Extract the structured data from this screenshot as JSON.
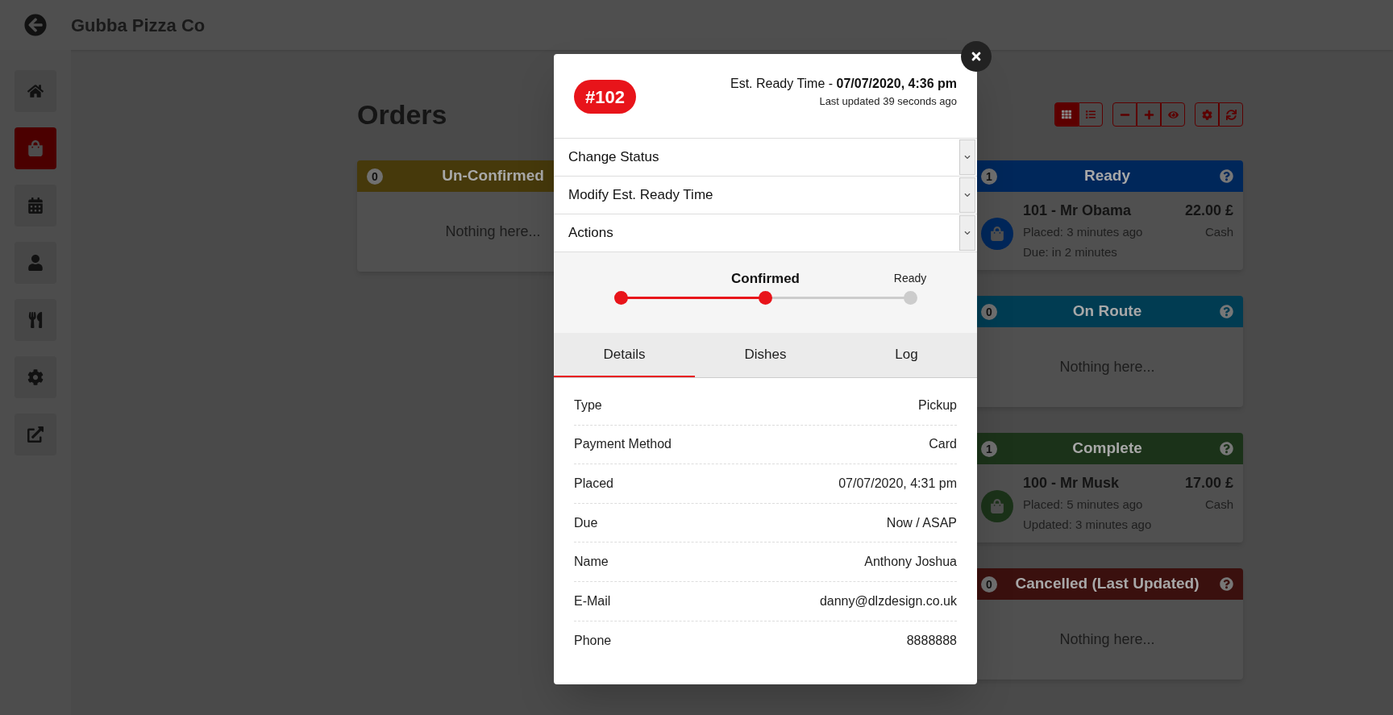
{
  "header": {
    "title": "Gubba Pizza Co"
  },
  "sidebar": {
    "items": [
      {
        "selected": false
      },
      {
        "selected": true
      },
      {
        "selected": false
      },
      {
        "selected": false
      },
      {
        "selected": false
      },
      {
        "selected": false
      },
      {
        "selected": false
      }
    ]
  },
  "page": {
    "title": "Orders"
  },
  "toolbar": {
    "view_toggle": [
      {
        "selected": true
      },
      {
        "selected": false
      }
    ]
  },
  "columns": [
    [
      {
        "title": "Un-Confirmed",
        "count": "0",
        "color": "#46390b",
        "empty_text": "Nothing here..."
      }
    ],
    [],
    [
      {
        "title": "Ready",
        "count": "1",
        "color": "#00275a",
        "orders": [
          {
            "title": "101 - Mr Obama",
            "lines": [
              "Placed: 3 minutes ago",
              "Due: in 2 minutes"
            ],
            "amount": "22.00 £",
            "payment": "Cash"
          }
        ]
      },
      {
        "title": "On Route",
        "count": "0",
        "color": "#013c52",
        "empty_text": "Nothing here..."
      },
      {
        "title": "Complete",
        "count": "1",
        "color": "#1b3219",
        "orders": [
          {
            "title": "100 - Mr Musk",
            "lines": [
              "Placed: 5 minutes ago",
              "Updated: 3 minutes ago"
            ],
            "amount": "17.00 £",
            "payment": "Cash"
          }
        ]
      },
      {
        "title": "Cancelled (Last Updated)",
        "count": "0",
        "color": "#3a100e",
        "empty_text": "Nothing here..."
      }
    ]
  ],
  "modal": {
    "order_number": "#102",
    "est_ready": "Est. Ready Time - **07/07/2020, 4:36 pm**",
    "last_updated": "Last updated 39 seconds ago",
    "sections": [
      {
        "label": "Change Status",
        "expanded": false
      },
      {
        "label": "Modify Est. Ready Time",
        "expanded": false
      },
      {
        "label": "Actions",
        "expanded": false
      }
    ],
    "progress": {
      "steps": [
        {
          "reached": true
        },
        {
          "label": "Confirmed",
          "reached": true
        },
        {
          "label": "Ready",
          "reached": false
        }
      ]
    },
    "tabs": [
      {
        "label": "Details",
        "selected": true
      },
      {
        "label": "Dishes",
        "selected": false
      },
      {
        "label": "Log",
        "selected": false
      }
    ],
    "details": [
      {
        "label": "Type",
        "value": "Pickup"
      },
      {
        "label": "Payment Method",
        "value": "Card"
      },
      {
        "label": "Placed",
        "value": "07/07/2020, 4:31 pm"
      },
      {
        "label": "Due",
        "value": "Now / ASAP"
      },
      {
        "label": "Name",
        "value": "Anthony Joshua"
      },
      {
        "label": "E-Mail",
        "value": "danny@dlzdesign.co.uk"
      },
      {
        "label": "Phone",
        "value": "8888888"
      }
    ]
  }
}
